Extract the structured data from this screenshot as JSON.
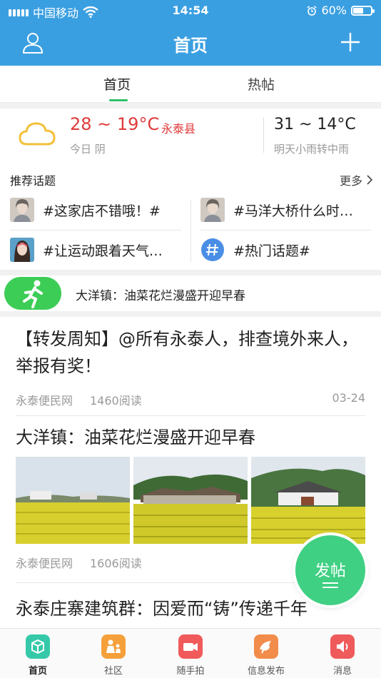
{
  "status_bar": {
    "carrier": "中国移动",
    "time": "14:54",
    "battery": "60%",
    "battery_level": 0.6
  },
  "nav": {
    "title": "首页"
  },
  "tabs": [
    {
      "label": "首页"
    },
    {
      "label": "热帖"
    }
  ],
  "weather": {
    "today_temp": "28 ~ 19°C",
    "location": "永泰县",
    "today_label": "今日 阴",
    "tomorrow_temp": "31 ~ 14°C",
    "tomorrow_label": "明天小雨转中雨"
  },
  "topics": {
    "title": "推荐话题",
    "more": "更多",
    "items": [
      {
        "label": "#这家店不错哦！#"
      },
      {
        "label": "#马洋大桥什么时…"
      },
      {
        "label": "#让运动跟着天气…"
      },
      {
        "label": "#热门话题#"
      }
    ]
  },
  "ticker": {
    "text": "大洋镇：油菜花烂漫盛开迎早春"
  },
  "feed": [
    {
      "title": "【转发周知】@所有永泰人，排查境外来人，举报有奖！",
      "source": "永泰便民网",
      "reads": "1460阅读",
      "date": "03-24"
    },
    {
      "title": "大洋镇：油菜花烂漫盛开迎早春",
      "source": "永泰便民网",
      "reads": "1606阅读"
    },
    {
      "title": "永泰庄寨建筑群：因爱而“铸”传递千年"
    }
  ],
  "fab": {
    "label": "发帖"
  },
  "tabbar": [
    {
      "label": "首页",
      "color": "#35c9a9"
    },
    {
      "label": "社区",
      "color": "#f5a03a"
    },
    {
      "label": "随手拍",
      "color": "#f05a5a"
    },
    {
      "label": "信息发布",
      "color": "#f28c4a"
    },
    {
      "label": "消息",
      "color": "#ef5b5b"
    }
  ],
  "colors": {
    "header": "#3a9fe1",
    "accent_green": "#2fbf6b",
    "weather_red": "#e03a3a"
  }
}
